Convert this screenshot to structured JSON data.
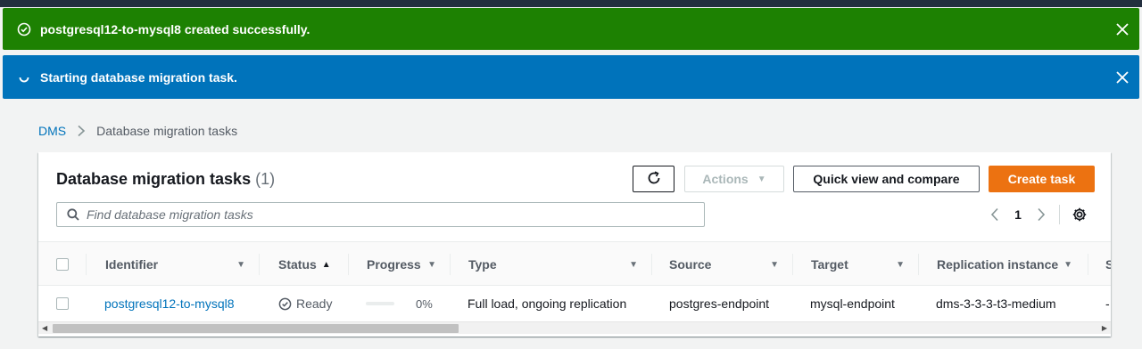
{
  "flash": {
    "success_message": "postgresql12-to-mysql8 created successfully.",
    "info_message": "Starting database migration task."
  },
  "breadcrumb": {
    "root": "DMS",
    "current": "Database migration tasks"
  },
  "header": {
    "title": "Database migration tasks",
    "count": "(1)"
  },
  "toolbar": {
    "actions_label": "Actions",
    "quick_view_label": "Quick view and compare",
    "create_label": "Create task"
  },
  "search": {
    "placeholder": "Find database migration tasks",
    "value": ""
  },
  "pagination": {
    "current_page": "1"
  },
  "table": {
    "columns": [
      "Identifier",
      "Status",
      "Progress",
      "Type",
      "Source",
      "Target",
      "Replication instance",
      "S"
    ],
    "rows": [
      {
        "identifier": "postgresql12-to-mysql8",
        "status": "Ready",
        "progress": 0,
        "progress_label": "0%",
        "type": "Full load, ongoing replication",
        "source": "postgres-endpoint",
        "target": "mysql-endpoint",
        "replication_instance": "dms-3-3-3-t3-medium",
        "extra": "-"
      }
    ]
  },
  "colors": {
    "success": "#1d8102",
    "info": "#0073bb",
    "primary": "#ec7211",
    "link": "#0073bb"
  },
  "icons": {
    "success": "check-circle-icon",
    "info": "loading-spinner-icon",
    "close": "close-icon",
    "refresh": "refresh-icon",
    "search": "search-icon",
    "settings": "gear-icon",
    "status_ready": "check-circle-icon"
  }
}
